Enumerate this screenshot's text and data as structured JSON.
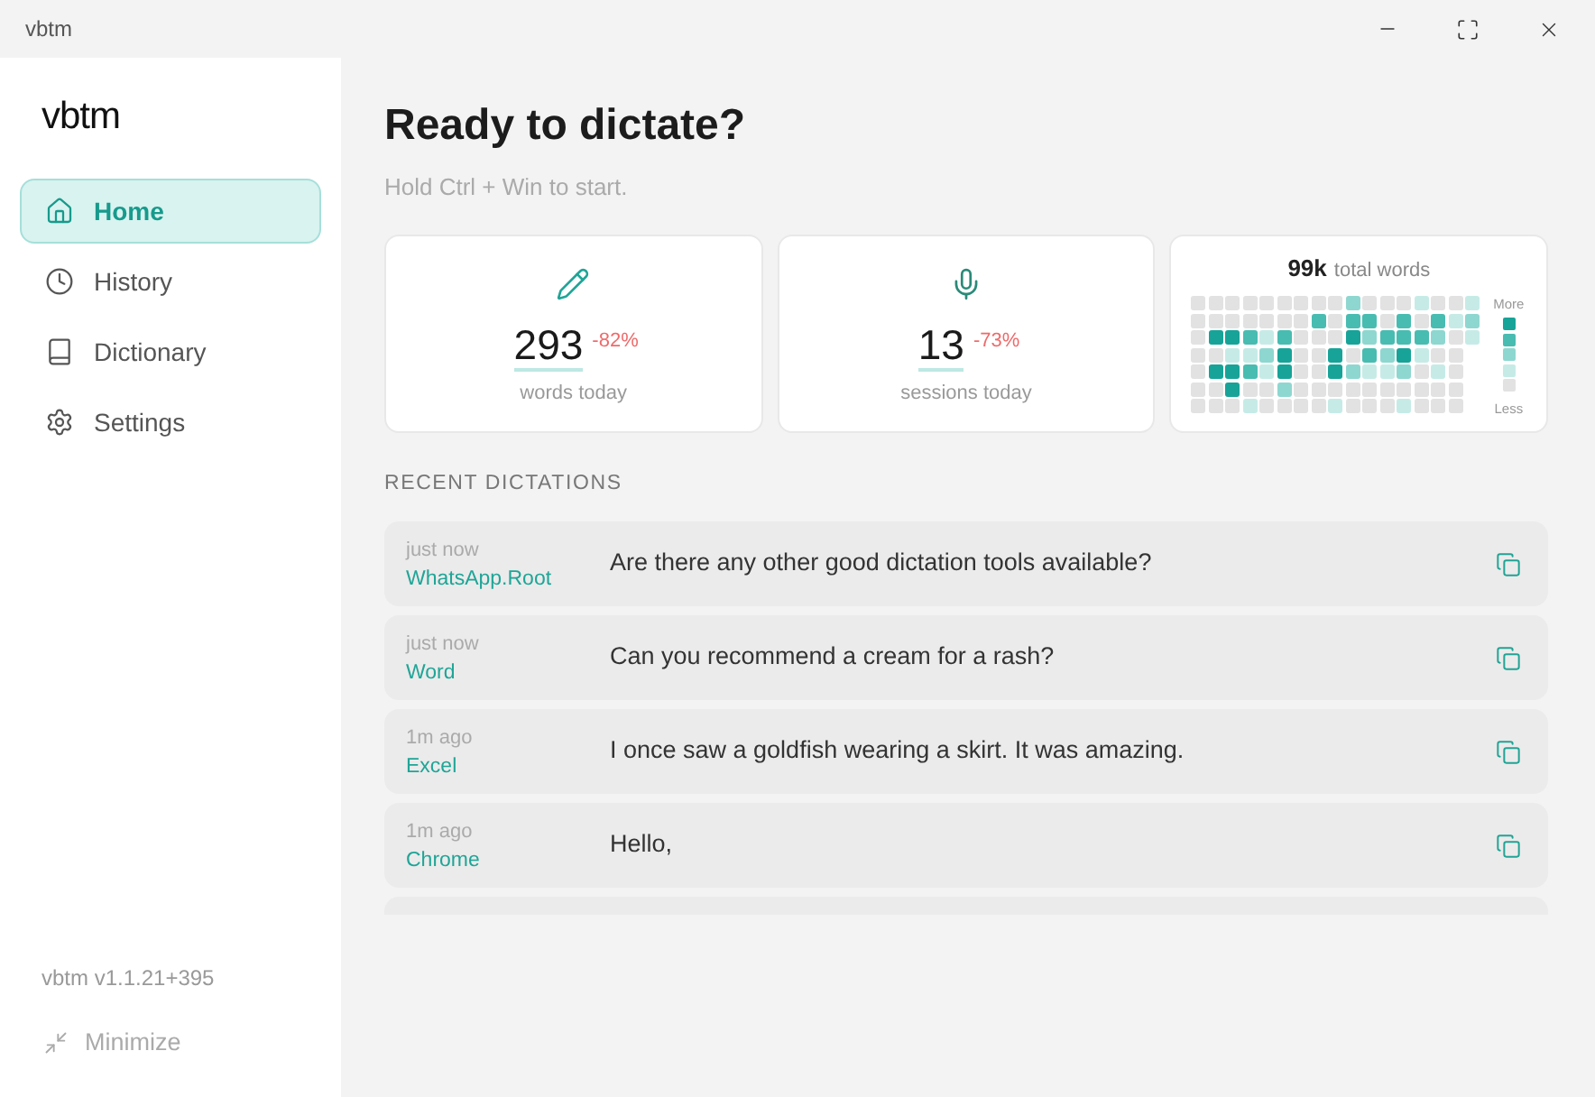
{
  "window": {
    "title": "vbtm"
  },
  "sidebar": {
    "logo": "vbtm",
    "items": [
      {
        "label": "Home",
        "selected": true
      },
      {
        "label": "History",
        "selected": false
      },
      {
        "label": "Dictionary",
        "selected": false
      },
      {
        "label": "Settings",
        "selected": false
      }
    ],
    "version": "vbtm v1.1.21+395",
    "minimize_label": "Minimize"
  },
  "header": {
    "title": "Ready to dictate?",
    "hint": "Hold Ctrl + Win to start."
  },
  "stats": [
    {
      "value": "293",
      "change": "-82%",
      "label": "words today"
    },
    {
      "value": "13",
      "change": "-73%",
      "label": "sessions today"
    }
  ],
  "total_words": {
    "value": "99k",
    "label": "total words",
    "legend_more": "More",
    "legend_less": "Less"
  },
  "recent": {
    "heading": "RECENT DICTATIONS",
    "items": [
      {
        "time": "just now",
        "app": "WhatsApp.Root",
        "text": "Are there any other good dictation tools available?"
      },
      {
        "time": "just now",
        "app": "Word",
        "text": "Can you recommend a cream for a rash?"
      },
      {
        "time": "1m ago",
        "app": "Excel",
        "text": "I once saw a goldfish wearing a skirt. It was amazing."
      },
      {
        "time": "1m ago",
        "app": "Chrome",
        "text": "Hello,"
      }
    ]
  }
}
